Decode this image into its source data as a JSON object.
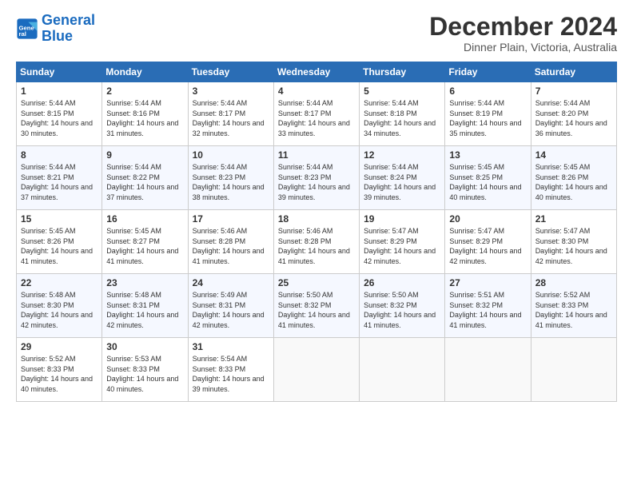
{
  "logo": {
    "line1": "General",
    "line2": "Blue"
  },
  "header": {
    "title": "December 2024",
    "subtitle": "Dinner Plain, Victoria, Australia"
  },
  "weekdays": [
    "Sunday",
    "Monday",
    "Tuesday",
    "Wednesday",
    "Thursday",
    "Friday",
    "Saturday"
  ],
  "weeks": [
    [
      {
        "day": "1",
        "sunrise": "5:44 AM",
        "sunset": "8:15 PM",
        "daylight": "14 hours and 30 minutes."
      },
      {
        "day": "2",
        "sunrise": "5:44 AM",
        "sunset": "8:16 PM",
        "daylight": "14 hours and 31 minutes."
      },
      {
        "day": "3",
        "sunrise": "5:44 AM",
        "sunset": "8:17 PM",
        "daylight": "14 hours and 32 minutes."
      },
      {
        "day": "4",
        "sunrise": "5:44 AM",
        "sunset": "8:17 PM",
        "daylight": "14 hours and 33 minutes."
      },
      {
        "day": "5",
        "sunrise": "5:44 AM",
        "sunset": "8:18 PM",
        "daylight": "14 hours and 34 minutes."
      },
      {
        "day": "6",
        "sunrise": "5:44 AM",
        "sunset": "8:19 PM",
        "daylight": "14 hours and 35 minutes."
      },
      {
        "day": "7",
        "sunrise": "5:44 AM",
        "sunset": "8:20 PM",
        "daylight": "14 hours and 36 minutes."
      }
    ],
    [
      {
        "day": "8",
        "sunrise": "5:44 AM",
        "sunset": "8:21 PM",
        "daylight": "14 hours and 37 minutes."
      },
      {
        "day": "9",
        "sunrise": "5:44 AM",
        "sunset": "8:22 PM",
        "daylight": "14 hours and 37 minutes."
      },
      {
        "day": "10",
        "sunrise": "5:44 AM",
        "sunset": "8:23 PM",
        "daylight": "14 hours and 38 minutes."
      },
      {
        "day": "11",
        "sunrise": "5:44 AM",
        "sunset": "8:23 PM",
        "daylight": "14 hours and 39 minutes."
      },
      {
        "day": "12",
        "sunrise": "5:44 AM",
        "sunset": "8:24 PM",
        "daylight": "14 hours and 39 minutes."
      },
      {
        "day": "13",
        "sunrise": "5:45 AM",
        "sunset": "8:25 PM",
        "daylight": "14 hours and 40 minutes."
      },
      {
        "day": "14",
        "sunrise": "5:45 AM",
        "sunset": "8:26 PM",
        "daylight": "14 hours and 40 minutes."
      }
    ],
    [
      {
        "day": "15",
        "sunrise": "5:45 AM",
        "sunset": "8:26 PM",
        "daylight": "14 hours and 41 minutes."
      },
      {
        "day": "16",
        "sunrise": "5:45 AM",
        "sunset": "8:27 PM",
        "daylight": "14 hours and 41 minutes."
      },
      {
        "day": "17",
        "sunrise": "5:46 AM",
        "sunset": "8:28 PM",
        "daylight": "14 hours and 41 minutes."
      },
      {
        "day": "18",
        "sunrise": "5:46 AM",
        "sunset": "8:28 PM",
        "daylight": "14 hours and 41 minutes."
      },
      {
        "day": "19",
        "sunrise": "5:47 AM",
        "sunset": "8:29 PM",
        "daylight": "14 hours and 42 minutes."
      },
      {
        "day": "20",
        "sunrise": "5:47 AM",
        "sunset": "8:29 PM",
        "daylight": "14 hours and 42 minutes."
      },
      {
        "day": "21",
        "sunrise": "5:47 AM",
        "sunset": "8:30 PM",
        "daylight": "14 hours and 42 minutes."
      }
    ],
    [
      {
        "day": "22",
        "sunrise": "5:48 AM",
        "sunset": "8:30 PM",
        "daylight": "14 hours and 42 minutes."
      },
      {
        "day": "23",
        "sunrise": "5:48 AM",
        "sunset": "8:31 PM",
        "daylight": "14 hours and 42 minutes."
      },
      {
        "day": "24",
        "sunrise": "5:49 AM",
        "sunset": "8:31 PM",
        "daylight": "14 hours and 42 minutes."
      },
      {
        "day": "25",
        "sunrise": "5:50 AM",
        "sunset": "8:32 PM",
        "daylight": "14 hours and 41 minutes."
      },
      {
        "day": "26",
        "sunrise": "5:50 AM",
        "sunset": "8:32 PM",
        "daylight": "14 hours and 41 minutes."
      },
      {
        "day": "27",
        "sunrise": "5:51 AM",
        "sunset": "8:32 PM",
        "daylight": "14 hours and 41 minutes."
      },
      {
        "day": "28",
        "sunrise": "5:52 AM",
        "sunset": "8:33 PM",
        "daylight": "14 hours and 41 minutes."
      }
    ],
    [
      {
        "day": "29",
        "sunrise": "5:52 AM",
        "sunset": "8:33 PM",
        "daylight": "14 hours and 40 minutes."
      },
      {
        "day": "30",
        "sunrise": "5:53 AM",
        "sunset": "8:33 PM",
        "daylight": "14 hours and 40 minutes."
      },
      {
        "day": "31",
        "sunrise": "5:54 AM",
        "sunset": "8:33 PM",
        "daylight": "14 hours and 39 minutes."
      },
      null,
      null,
      null,
      null
    ]
  ]
}
